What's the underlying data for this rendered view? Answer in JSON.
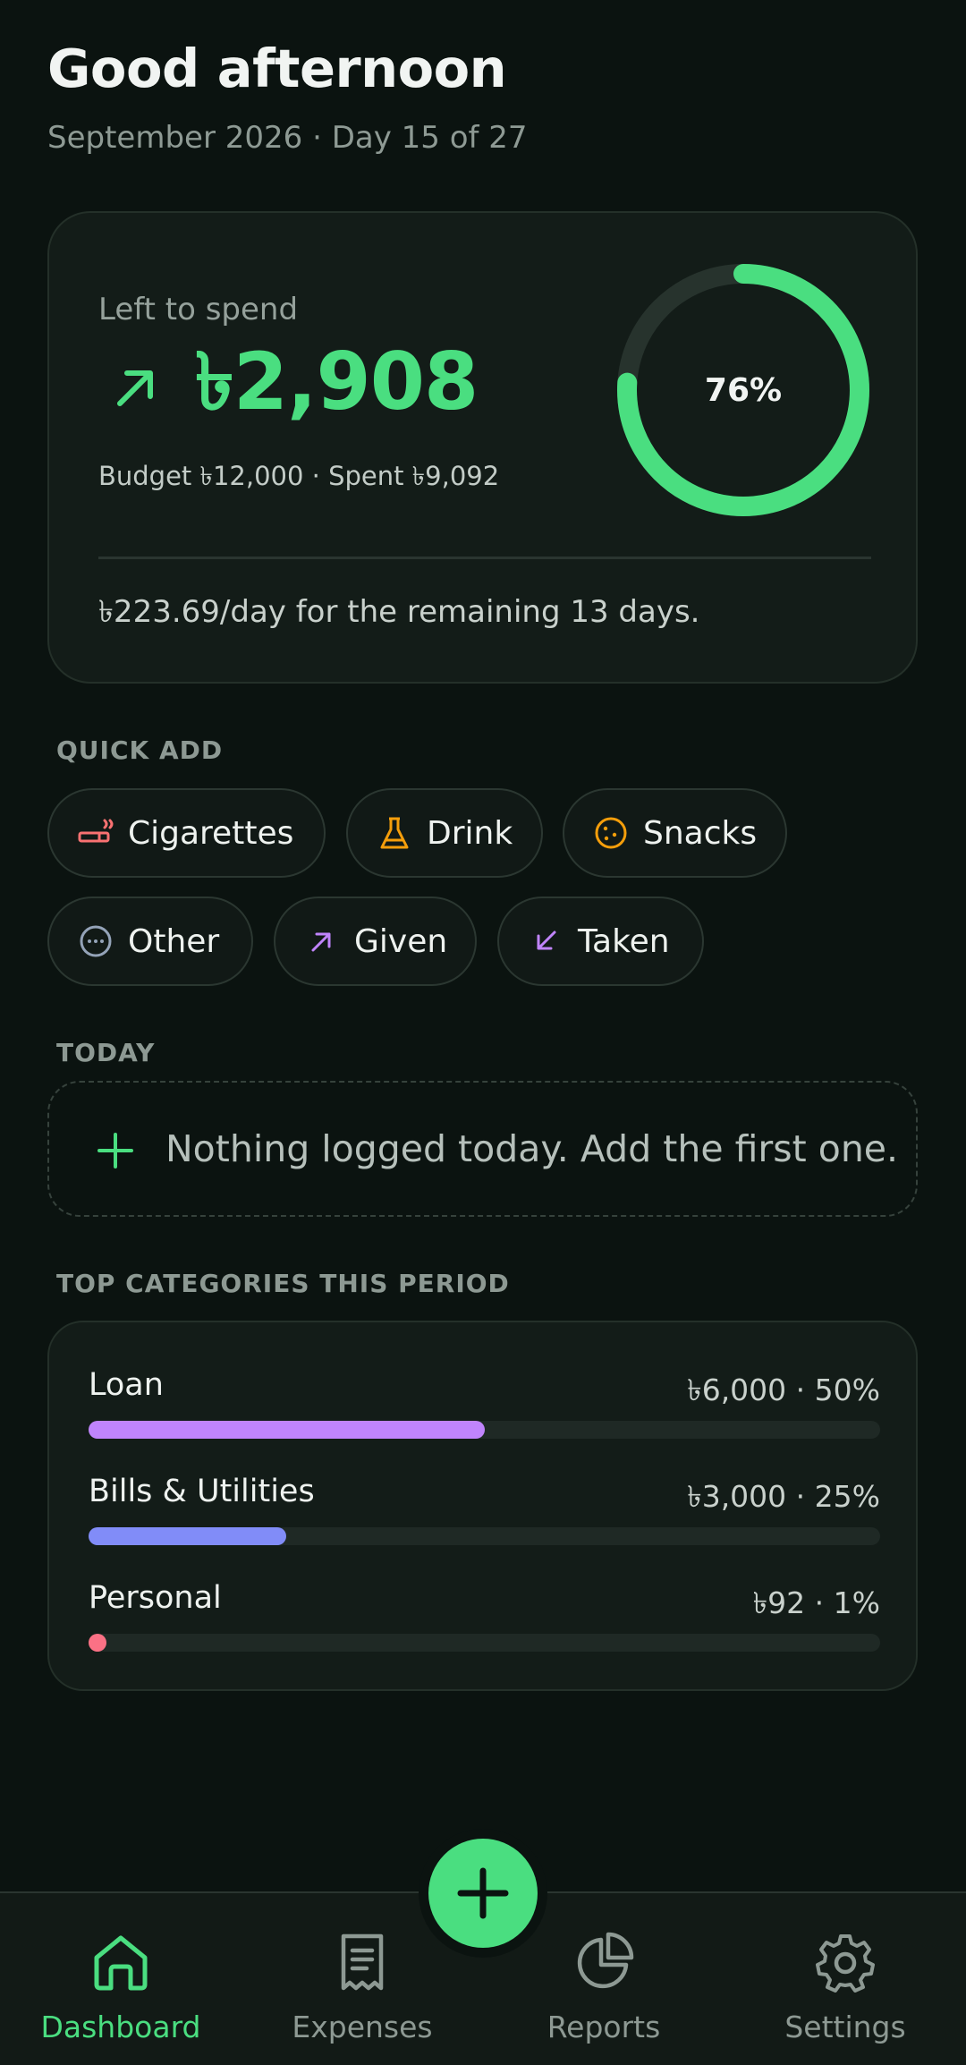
{
  "header": {
    "greeting": "Good afternoon",
    "subtitle": "September 2026 · Day 15 of 27"
  },
  "budget": {
    "left_label": "Left to spend",
    "amount": "৳2,908",
    "budget_line": "Budget ৳12,000 · Spent ৳9,092",
    "ring_label": "76%",
    "ring_fraction": 0.76,
    "per_day": "৳223.69/day for the remaining 13 days.",
    "accent": "#4ade80"
  },
  "quick_add": {
    "label": "QUICK ADD",
    "chips": [
      {
        "label": "Cigarettes",
        "icon": "cigarette-icon",
        "color": "#f87171"
      },
      {
        "label": "Drink",
        "icon": "flask-icon",
        "color": "#f59e0b"
      },
      {
        "label": "Snacks",
        "icon": "cookie-icon",
        "color": "#f59e0b"
      },
      {
        "label": "Other",
        "icon": "more-icon",
        "color": "#94a3b8"
      },
      {
        "label": "Given",
        "icon": "arrow-up-right-icon",
        "color": "#c084fc"
      },
      {
        "label": "Taken",
        "icon": "arrow-down-left-icon",
        "color": "#c084fc"
      }
    ]
  },
  "today": {
    "label": "TODAY",
    "empty_text": "Nothing logged today. Add the first one."
  },
  "categories": {
    "label": "TOP CATEGORIES THIS PERIOD",
    "items": [
      {
        "name": "Loan",
        "value": "৳6,000 · 50%",
        "fraction": 0.5,
        "color": "#c084fc"
      },
      {
        "name": "Bills & Utilities",
        "value": "৳3,000 · 25%",
        "fraction": 0.25,
        "color": "#818cf8"
      },
      {
        "name": "Personal",
        "value": "৳92 · 1%",
        "fraction": 0.01,
        "color": "#fb7185"
      }
    ]
  },
  "nav": {
    "items": [
      {
        "label": "Dashboard",
        "icon": "home-icon",
        "active": true
      },
      {
        "label": "Expenses",
        "icon": "receipt-icon",
        "active": false
      },
      {
        "label": "Reports",
        "icon": "pie-chart-icon",
        "active": false
      },
      {
        "label": "Settings",
        "icon": "gear-icon",
        "active": false
      }
    ]
  }
}
